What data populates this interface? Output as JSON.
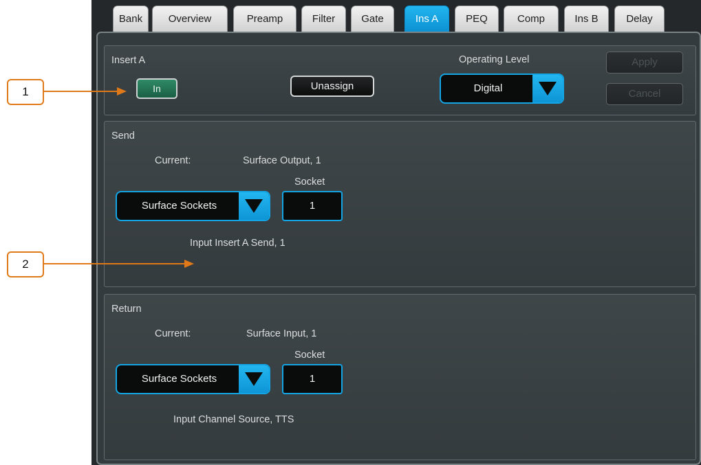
{
  "tabs": [
    {
      "label": "Bank",
      "active": false
    },
    {
      "label": "Overview",
      "active": false
    },
    {
      "label": "Preamp",
      "active": false
    },
    {
      "label": "Filter",
      "active": false
    },
    {
      "label": "Gate",
      "active": false
    },
    {
      "label": "Ins A",
      "active": true
    },
    {
      "label": "PEQ",
      "active": false
    },
    {
      "label": "Comp",
      "active": false
    },
    {
      "label": "Ins B",
      "active": false
    },
    {
      "label": "Delay",
      "active": false
    }
  ],
  "insert": {
    "title": "Insert A",
    "in_label": "In",
    "unassign_label": "Unassign",
    "operating_level_label": "Operating Level",
    "operating_level_value": "Digital",
    "apply_label": "Apply",
    "cancel_label": "Cancel"
  },
  "send": {
    "title": "Send",
    "current_label": "Current:",
    "current_value": "Surface Output, 1",
    "socket_label": "Socket",
    "source_value": "Surface Sockets",
    "socket_value": "1",
    "destination": "Input Insert A Send, 1"
  },
  "return": {
    "title": "Return",
    "current_label": "Current:",
    "current_value": "Surface Input, 1",
    "socket_label": "Socket",
    "source_value": "Surface Sockets",
    "socket_value": "1",
    "destination": "Input Channel Source, TTS"
  },
  "callouts": [
    "1",
    "2"
  ],
  "colors": {
    "accent": "#13a6e6",
    "callout": "#e07a18",
    "in_button": "#2f8a66"
  },
  "icons": {
    "dropdown_arrow": "triangle-down-icon"
  }
}
